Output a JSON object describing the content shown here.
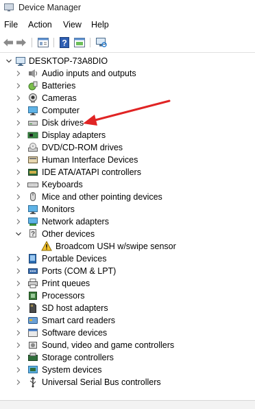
{
  "window": {
    "title": "Device Manager"
  },
  "menu": [
    "File",
    "Action",
    "View",
    "Help"
  ],
  "toolbar": {
    "buttons": [
      "back-icon",
      "forward-icon",
      "properties-icon",
      "help-icon",
      "update-driver-icon",
      "scan-hardware-icon"
    ]
  },
  "tree": {
    "root": "DESKTOP-73A8DIO",
    "items": [
      {
        "label": "Audio inputs and outputs",
        "icon": "speaker-icon"
      },
      {
        "label": "Batteries",
        "icon": "battery-icon"
      },
      {
        "label": "Cameras",
        "icon": "camera-icon"
      },
      {
        "label": "Computer",
        "icon": "monitor-icon"
      },
      {
        "label": "Disk drives",
        "icon": "disk-drive-icon"
      },
      {
        "label": "Display adapters",
        "icon": "display-adapter-icon"
      },
      {
        "label": "DVD/CD-ROM drives",
        "icon": "dvd-drive-icon"
      },
      {
        "label": "Human Interface Devices",
        "icon": "hid-icon"
      },
      {
        "label": "IDE ATA/ATAPI controllers",
        "icon": "ide-controller-icon"
      },
      {
        "label": "Keyboards",
        "icon": "keyboard-icon"
      },
      {
        "label": "Mice and other pointing devices",
        "icon": "mouse-icon"
      },
      {
        "label": "Monitors",
        "icon": "monitor-icon"
      },
      {
        "label": "Network adapters",
        "icon": "network-adapter-icon"
      },
      {
        "label": "Other devices",
        "icon": "unknown-device-icon",
        "expanded": true
      },
      {
        "label": "Broadcom USH w/swipe sensor",
        "icon": "warning-icon",
        "child": true
      },
      {
        "label": "Portable Devices",
        "icon": "portable-device-icon"
      },
      {
        "label": "Ports (COM & LPT)",
        "icon": "port-icon"
      },
      {
        "label": "Print queues",
        "icon": "printer-icon"
      },
      {
        "label": "Processors",
        "icon": "processor-icon"
      },
      {
        "label": "SD host adapters",
        "icon": "sd-card-icon"
      },
      {
        "label": "Smart card readers",
        "icon": "smart-card-icon"
      },
      {
        "label": "Software devices",
        "icon": "software-device-icon"
      },
      {
        "label": "Sound, video and game controllers",
        "icon": "sound-controller-icon"
      },
      {
        "label": "Storage controllers",
        "icon": "storage-controller-icon"
      },
      {
        "label": "System devices",
        "icon": "system-device-icon"
      },
      {
        "label": "Universal Serial Bus controllers",
        "icon": "usb-icon"
      }
    ]
  },
  "annotation": {
    "color": "#e02424"
  }
}
